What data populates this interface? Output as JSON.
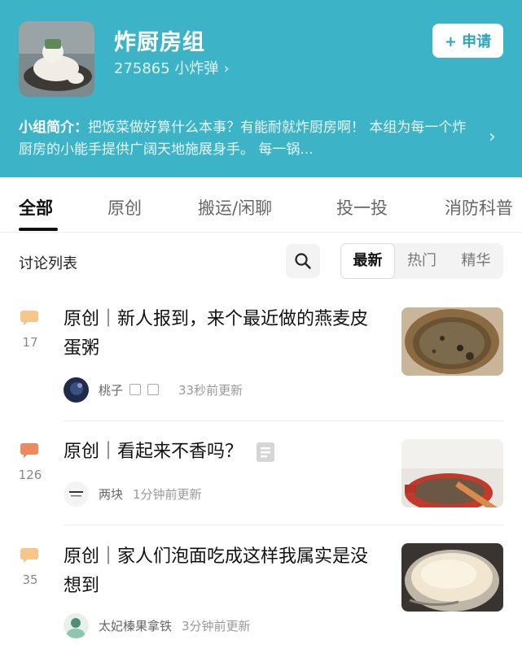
{
  "group": {
    "title": "炸厨房组",
    "meta": "275865 小炸弹",
    "meta_chevron": "›",
    "apply_label": "+ 申请",
    "intro_label": "小组简介：",
    "intro_text": "把饭菜做好算什么本事？有能耐就炸厨房啊！ 本组为每一个炸厨房的小能手提供广阔天地施展身手。 每一锅...",
    "intro_chevron": "›",
    "brand_color": "#3cb3c6"
  },
  "tabs": [
    {
      "label": "全部"
    },
    {
      "label": "原创"
    },
    {
      "label": "搬运/闲聊"
    },
    {
      "label": "投一投"
    },
    {
      "label": "消防科普"
    }
  ],
  "toolbar": {
    "title": "讨论列表",
    "search_icon": "search-icon",
    "sort_options": [
      {
        "label": "最新"
      },
      {
        "label": "热门"
      },
      {
        "label": "精华"
      }
    ]
  },
  "posts": [
    {
      "count": "17",
      "title": "原创｜新人报到，来个最近做的燕麦皮蛋粥",
      "author": "桃子",
      "time": "33秒前更新",
      "bubble_color": "#f7c68a"
    },
    {
      "count": "126",
      "title": "原创｜看起来不香吗？",
      "author": "两块",
      "time": "1分钟前更新",
      "bubble_color": "#ef8a5f"
    },
    {
      "count": "35",
      "title": "原创｜家人们泡面吃成这样我属实是没想到",
      "author": "太妃榛果拿铁",
      "time": "3分钟前更新",
      "bubble_color": "#f7c68a"
    }
  ]
}
